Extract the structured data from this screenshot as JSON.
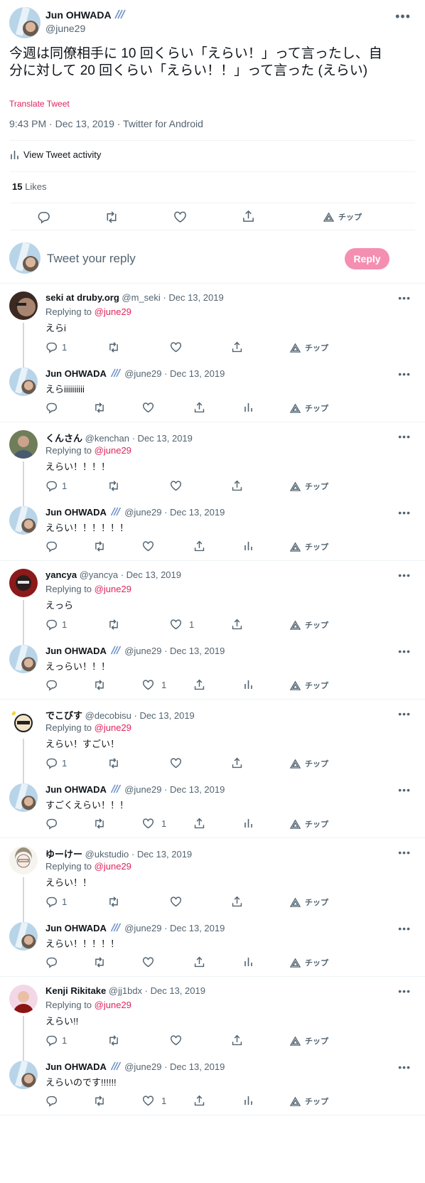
{
  "main": {
    "author_name": "Jun OHWADA",
    "author_handle": "@june29",
    "text": "今週は同僚相手に 10 回くらい「えらい！」って言ったし、自分に対して 20 回くらい「えらい！！」って言った (えらい)",
    "translate": "Translate Tweet",
    "meta": "9:43 PM · Dec 13, 2019 · Twitter for Android",
    "activity": "View Tweet activity",
    "likes_count": "15",
    "likes_label": "Likes",
    "tip_label": "チップ"
  },
  "compose": {
    "placeholder": "Tweet your reply",
    "button": "Reply"
  },
  "common": {
    "replying_to": "Replying to",
    "tip": "チップ",
    "mention": "@june29"
  },
  "threads": [
    {
      "reply": {
        "name": "seki at druby.org",
        "handle": "@m_seki",
        "date": " · Dec 13, 2019",
        "text": "えらi",
        "replies": "1",
        "likes": ""
      },
      "response": {
        "name": "Jun OHWADA",
        "handle": "@june29",
        "date": " · Dec 13, 2019",
        "text": "えらiiiiiiiiii",
        "likes": ""
      }
    },
    {
      "reply": {
        "name": "くんさん",
        "handle": "@kenchan",
        "date": " · Dec 13, 2019",
        "text": "えらい！！！！",
        "replies": "1",
        "likes": ""
      },
      "response": {
        "name": "Jun OHWADA",
        "handle": "@june29",
        "date": " · Dec 13, 2019",
        "text": "えらい！！！！！！",
        "likes": ""
      }
    },
    {
      "reply": {
        "name": "yancya",
        "handle": "@yancya",
        "date": " · Dec 13, 2019",
        "text": "えっら",
        "replies": "1",
        "likes": "1"
      },
      "response": {
        "name": "Jun OHWADA",
        "handle": "@june29",
        "date": " · Dec 13, 2019",
        "text": "えっらい！！！",
        "likes": "1"
      }
    },
    {
      "reply": {
        "name": "でこびす",
        "handle": "@decobisu",
        "date": " · Dec 13, 2019",
        "text": "えらい！すごい！",
        "replies": "1",
        "likes": ""
      },
      "response": {
        "name": "Jun OHWADA",
        "handle": "@june29",
        "date": " · Dec 13, 2019",
        "text": "すごくえらい！！！",
        "likes": "1"
      }
    },
    {
      "reply": {
        "name": "ゆーけー",
        "handle": "@ukstudio",
        "date": " · Dec 13, 2019",
        "text": "えらい！！",
        "replies": "1",
        "likes": ""
      },
      "response": {
        "name": "Jun OHWADA",
        "handle": "@june29",
        "date": " · Dec 13, 2019",
        "text": "えらい！！！！！",
        "likes": ""
      }
    },
    {
      "reply": {
        "name": "Kenji Rikitake",
        "handle": "@jj1bdx",
        "date": " · Dec 13, 2019",
        "text": "えらい!!",
        "replies": "1",
        "likes": ""
      },
      "response": {
        "name": "Jun OHWADA",
        "handle": "@june29",
        "date": " · Dec 13, 2019",
        "text": "えらいのです!!!!!!",
        "likes": "1"
      }
    }
  ],
  "colors": {
    "accent": "#e0245e",
    "reply_button": "#f48fb1",
    "muted": "#536471"
  },
  "icons": [
    "reply-icon",
    "retweet-icon",
    "like-icon",
    "share-icon",
    "analytics-icon",
    "tip-icon",
    "more-icon",
    "badge-icon"
  ]
}
